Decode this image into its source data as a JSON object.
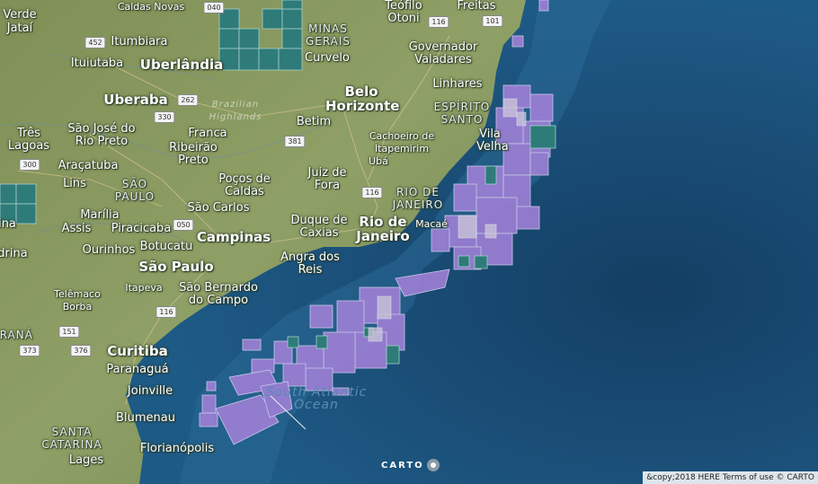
{
  "colors": {
    "ocean": "#1b4f78",
    "land": "#8a9a5b",
    "block_purple": "#9b7fd4",
    "block_teal": "#2e7b7a",
    "block_outline": "#d8d0f0"
  },
  "labels": [
    {
      "name": "city-verde",
      "text": "Verde"
    },
    {
      "name": "city-jatai",
      "text": "Jataí"
    },
    {
      "name": "city-caldas-novas",
      "text": "Caldas Novas"
    },
    {
      "name": "city-itumbiara",
      "text": "Itumbiara"
    },
    {
      "name": "city-ituiutaba",
      "text": "Ituiutaba"
    },
    {
      "name": "city-uberlandia",
      "text": "Uberlândia"
    },
    {
      "name": "city-uberaba",
      "text": "Uberaba"
    },
    {
      "name": "city-tres-lagoas",
      "text": "Três Lagoas"
    },
    {
      "name": "city-sao-jose-rio-preto",
      "text": "São José do Rio Preto"
    },
    {
      "name": "city-franca",
      "text": "Franca"
    },
    {
      "name": "city-ribeirao-preto",
      "text": "Ribeirão Preto"
    },
    {
      "name": "city-aracatuba",
      "text": "Araçatuba"
    },
    {
      "name": "city-lins",
      "text": "Lins"
    },
    {
      "name": "state-sao-paulo",
      "text": "SÃO PAULO"
    },
    {
      "name": "city-marilia",
      "text": "Marília"
    },
    {
      "name": "city-assis",
      "text": "Assis"
    },
    {
      "name": "city-ourinhos",
      "text": "Ourinhos"
    },
    {
      "name": "city-piracicaba",
      "text": "Piracicaba"
    },
    {
      "name": "city-botucatu",
      "text": "Botucatu"
    },
    {
      "name": "city-campinas",
      "text": "Campinas"
    },
    {
      "name": "city-sao-carlos",
      "text": "São Carlos"
    },
    {
      "name": "city-pocos-de-caldas",
      "text": "Poços de Caldas"
    },
    {
      "name": "city-sao-paulo",
      "text": "São Paulo"
    },
    {
      "name": "city-sao-bernardo",
      "text": "São Bernardo do Campo"
    },
    {
      "name": "city-itapeva",
      "text": "Itapeva"
    },
    {
      "name": "city-telemaco-borba",
      "text": "Telêmaco Borba"
    },
    {
      "name": "state-parana",
      "text": "PARANÁ"
    },
    {
      "name": "city-curitiba",
      "text": "Curitiba"
    },
    {
      "name": "city-paranagua",
      "text": "Paranaguá"
    },
    {
      "name": "city-joinville",
      "text": "Joinville"
    },
    {
      "name": "city-blumenau",
      "text": "Blumenau"
    },
    {
      "name": "state-santa-catarina",
      "text": "SANTA CATARINA"
    },
    {
      "name": "city-lages",
      "text": "Lages"
    },
    {
      "name": "city-florianopolis",
      "text": "Florianópolis"
    },
    {
      "name": "city-drina",
      "text": "drina"
    },
    {
      "name": "city-ina",
      "text": "ina"
    },
    {
      "name": "state-minas-gerais",
      "text": "MINAS GERAIS"
    },
    {
      "name": "city-curvelo",
      "text": "Curvelo"
    },
    {
      "name": "city-belo-horizonte",
      "text": "Belo Horizonte"
    },
    {
      "name": "city-betim",
      "text": "Betim"
    },
    {
      "name": "region-brazilian-highlands",
      "text": "Brazilian Highlands"
    },
    {
      "name": "city-teofilo-otoni",
      "text": "Teófilo Otoni"
    },
    {
      "name": "city-freitas",
      "text": "Freitas"
    },
    {
      "name": "city-governador-valadares",
      "text": "Governador Valadares"
    },
    {
      "name": "city-linhares",
      "text": "Linhares"
    },
    {
      "name": "state-espirito-santo",
      "text": "ESPÍRITO SANTO"
    },
    {
      "name": "city-cachoeiro",
      "text": "Cachoeiro de Itapemirim"
    },
    {
      "name": "city-uba",
      "text": "Ubá"
    },
    {
      "name": "city-vila-velha",
      "text": "Vila Velha"
    },
    {
      "name": "city-juiz-de-fora",
      "text": "Juiz de Fora"
    },
    {
      "name": "state-rio-de-janeiro",
      "text": "RIO DE JANEIRO"
    },
    {
      "name": "city-macae",
      "text": "Macaé"
    },
    {
      "name": "city-duque-de-caxias",
      "text": "Duque de Caxias"
    },
    {
      "name": "city-rio-de-janeiro",
      "text": "Rio de Janeiro"
    },
    {
      "name": "city-angra-dos-reis",
      "text": "Angra dos Reis"
    },
    {
      "name": "ocean-south-atlantic",
      "text": "South Atlantic Ocean"
    }
  ],
  "road_shields": [
    {
      "name": "shield-040",
      "text": "040"
    },
    {
      "name": "shield-452",
      "text": "452"
    },
    {
      "name": "shield-262",
      "text": "262"
    },
    {
      "name": "shield-330",
      "text": "330"
    },
    {
      "name": "shield-381",
      "text": "381"
    },
    {
      "name": "shield-300",
      "text": "300"
    },
    {
      "name": "shield-050",
      "text": "050"
    },
    {
      "name": "shield-116-north",
      "text": "116"
    },
    {
      "name": "shield-116-south",
      "text": "116"
    },
    {
      "name": "shield-151",
      "text": "151"
    },
    {
      "name": "shield-373",
      "text": "373"
    },
    {
      "name": "shield-376",
      "text": "376"
    },
    {
      "name": "shield-101",
      "text": "101"
    },
    {
      "name": "shield-116-east",
      "text": "116"
    }
  ],
  "logo": {
    "text": "CARTO"
  },
  "attribution": {
    "text": "&copy;2018 HERE Terms of use © CARTO"
  }
}
